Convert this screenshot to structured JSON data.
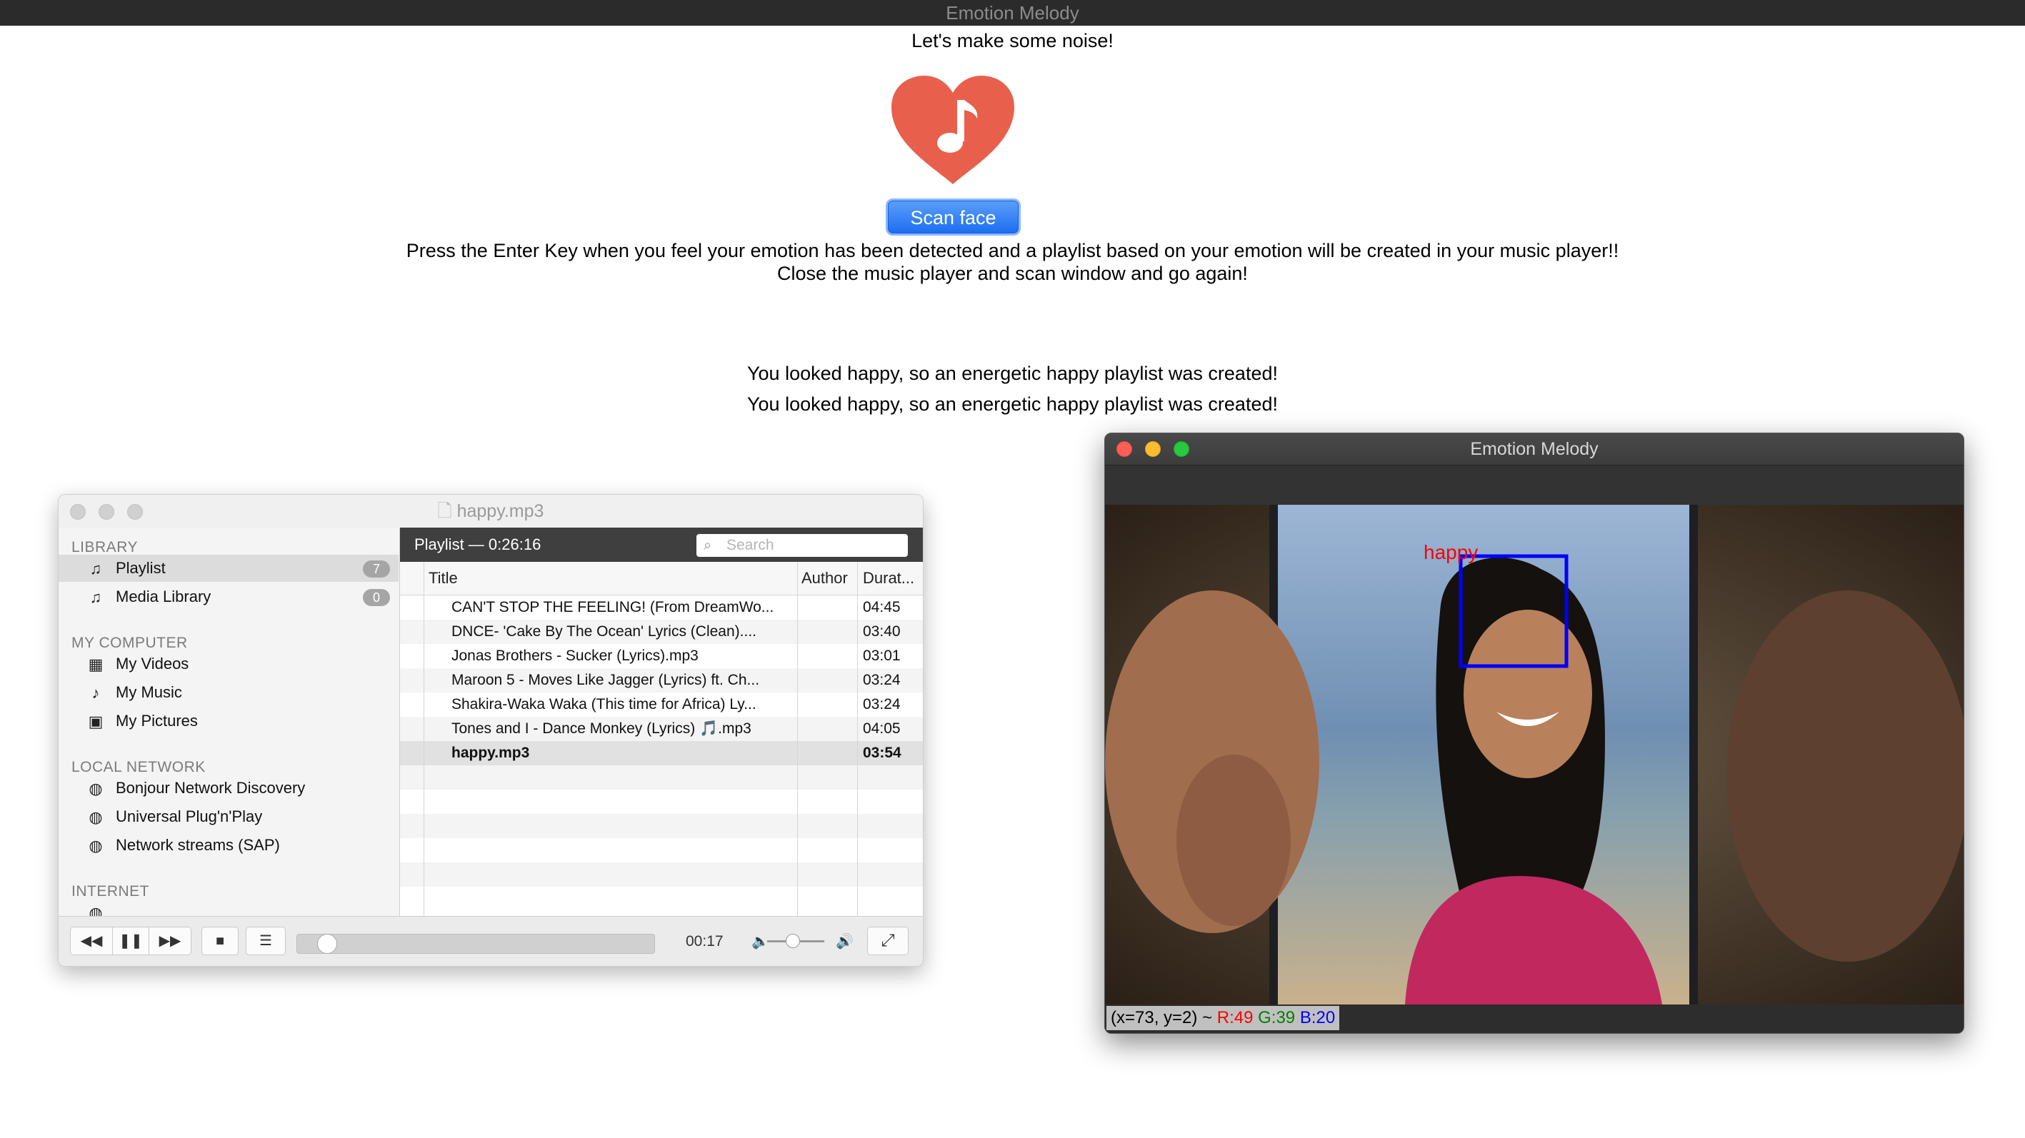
{
  "app": {
    "title": "Emotion Melody",
    "tagline": "Let's make some noise!",
    "scan_button": "Scan face",
    "instructions_1": "Press the Enter Key when you feel your emotion has been detected and a playlist based on your emotion will be created in your music player!!",
    "instructions_2": "Close the music player and scan window and go again!",
    "results": [
      "You looked happy, so an energetic happy playlist was created!",
      "You looked happy, so an energetic happy playlist was created!"
    ],
    "heart_color": "#e8604c"
  },
  "vlc": {
    "window_title": "happy.mp3",
    "sidebar": {
      "library_header": "LIBRARY",
      "library": [
        {
          "label": "Playlist",
          "count": "7",
          "icon": "playlist-icon"
        },
        {
          "label": "Media Library",
          "count": "0",
          "icon": "media-library-icon"
        }
      ],
      "computer_header": "MY COMPUTER",
      "computer": [
        {
          "label": "My Videos",
          "icon": "film-icon"
        },
        {
          "label": "My Music",
          "icon": "music-note-icon"
        },
        {
          "label": "My Pictures",
          "icon": "picture-icon"
        }
      ],
      "network_header": "LOCAL NETWORK",
      "network": [
        {
          "label": "Bonjour Network Discovery",
          "icon": "network-icon"
        },
        {
          "label": "Universal Plug'n'Play",
          "icon": "network-icon"
        },
        {
          "label": "Network streams (SAP)",
          "icon": "network-icon"
        }
      ],
      "internet_header": "INTERNET"
    },
    "playlist_header": "Playlist — 0:26:16",
    "search_placeholder": "Search",
    "columns": {
      "title": "Title",
      "author": "Author",
      "duration": "Durat..."
    },
    "tracks": [
      {
        "title": "CAN'T STOP THE FEELING! (From DreamWo...",
        "duration": "04:45"
      },
      {
        "title": "DNCE- 'Cake By The Ocean' Lyrics (Clean)....",
        "duration": "03:40"
      },
      {
        "title": "Jonas Brothers - Sucker (Lyrics).mp3",
        "duration": "03:01"
      },
      {
        "title": "Maroon 5 - Moves Like Jagger (Lyrics) ft. Ch...",
        "duration": "03:24"
      },
      {
        "title": "Shakira-Waka Waka (This time for Africa) Ly...",
        "duration": "03:24"
      },
      {
        "title": "Tones and I - Dance Monkey (Lyrics) 🎵.mp3",
        "duration": "04:05"
      },
      {
        "title": "happy.mp3",
        "duration": "03:54"
      }
    ],
    "current_track_index": 6,
    "elapsed": "00:17",
    "progress_fraction": 0.06,
    "volume_fraction": 0.45
  },
  "camera": {
    "window_title": "Emotion Melody",
    "detected_label": "happy",
    "status_coords": "(x=73, y=2) ~",
    "status_r": "R:49",
    "status_g": "G:39",
    "status_b": "B:20",
    "box_color": "#0000ff",
    "label_color": "#ff0000"
  }
}
